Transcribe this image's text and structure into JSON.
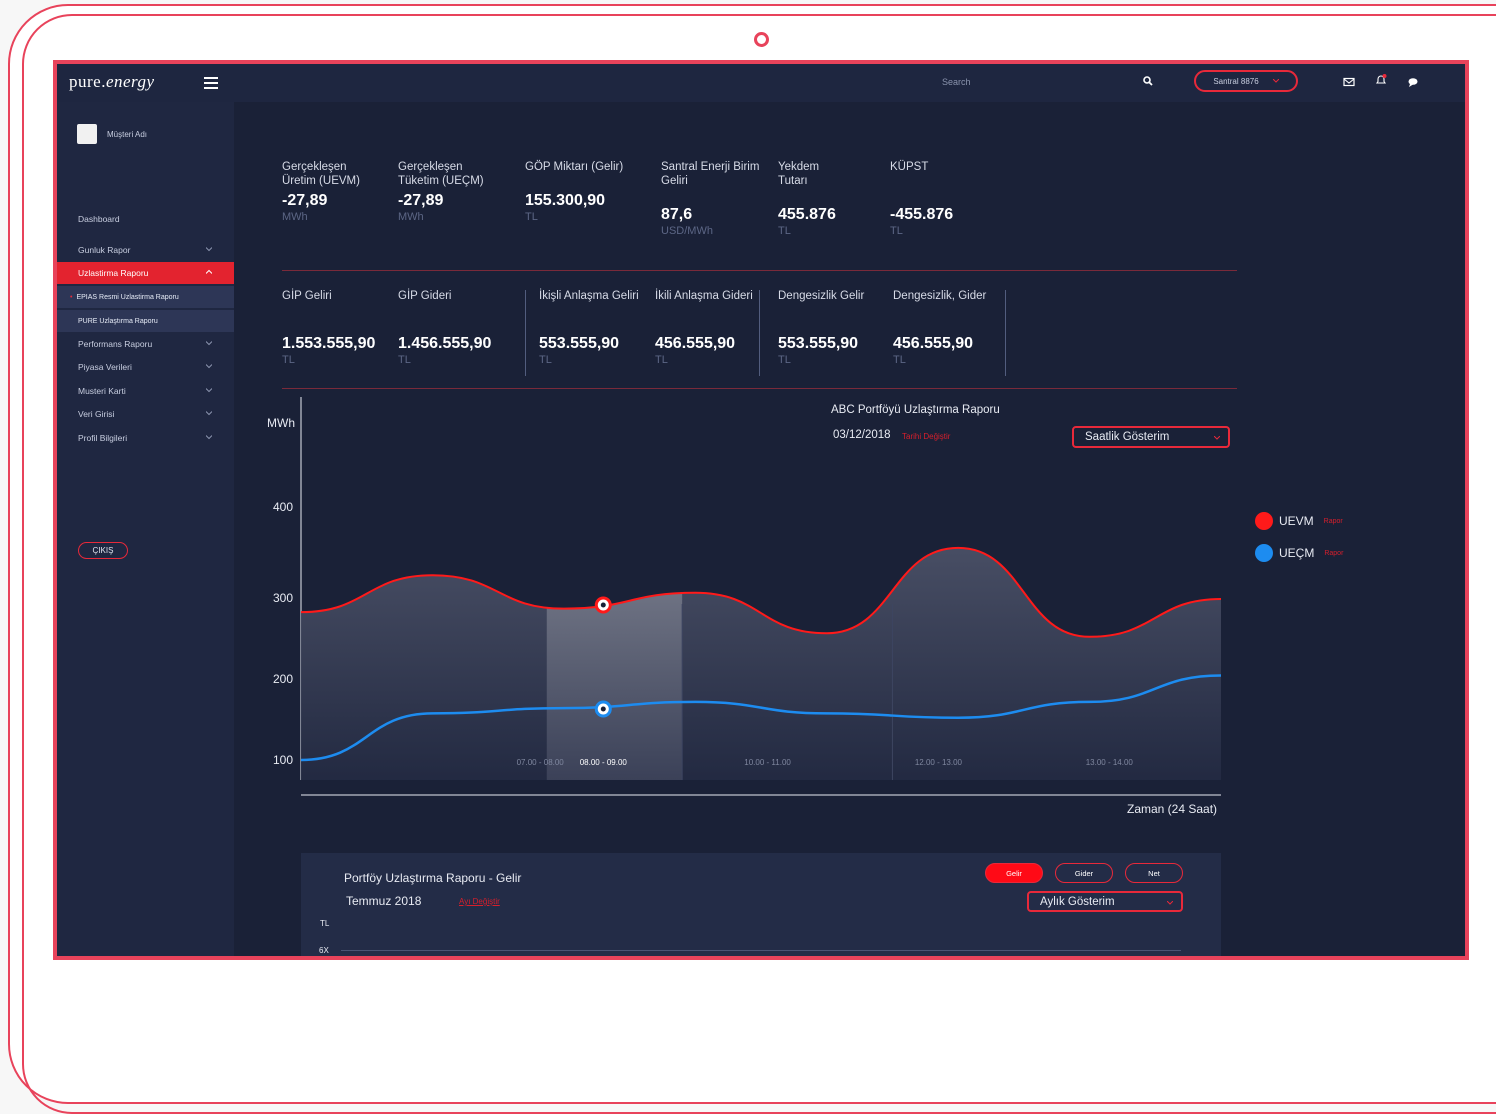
{
  "topbar": {
    "brand_plain": "pure.",
    "brand_italic": "energy",
    "search_placeholder": "Search",
    "plant_selector": "Santral 8876"
  },
  "sidebar": {
    "customer_name": "Müşteri Adı",
    "items": [
      {
        "label": "Dashboard"
      },
      {
        "label": "Gunluk Rapor"
      },
      {
        "label": "Uzlastirma Raporu"
      },
      {
        "label": "EPIAS Resmi Uzlastirma Raporu"
      },
      {
        "label": "PURE Uzlaştırma Raporu"
      },
      {
        "label": "Performans Raporu"
      },
      {
        "label": "Piyasa Verileri"
      },
      {
        "label": "Musteri Karti"
      },
      {
        "label": "Veri Girisi"
      },
      {
        "label": "Profil Bilgileri"
      }
    ],
    "logout": "ÇIKIŞ"
  },
  "stats_row1": [
    {
      "label": "Gerçekleşen Üretim (UEVM)",
      "value": "-27,89",
      "unit": "MWh"
    },
    {
      "label": "Gerçekleşen Tüketim (UEÇM)",
      "value": "-27,89",
      "unit": "MWh"
    },
    {
      "label": "GÖP Miktarı (Gelir)",
      "value": "155.300,90",
      "unit": "TL"
    },
    {
      "label": "Santral Enerji Birim Geliri",
      "value": "87,6",
      "unit": "USD/MWh"
    },
    {
      "label": "Yekdem Tutarı",
      "value": "455.876",
      "unit": "TL"
    },
    {
      "label": "KÜPST",
      "value": "-455.876",
      "unit": "TL"
    }
  ],
  "stats_row2": [
    {
      "label": "GİP Geliri",
      "value": "1.553.555,90",
      "unit": "TL"
    },
    {
      "label": "GİP Gideri",
      "value": "1.456.555,90",
      "unit": "TL"
    },
    {
      "label": "İkişli Anlaşma Geliri",
      "value": "553.555,90",
      "unit": "TL"
    },
    {
      "label": "İkili Anlaşma Gideri",
      "value": "456.555,90",
      "unit": "TL"
    },
    {
      "label": "Dengesizlik Gelir",
      "value": "553.555,90",
      "unit": "TL"
    },
    {
      "label": "Dengesizlik, Gider",
      "value": "456.555,90",
      "unit": "TL"
    }
  ],
  "chart": {
    "title": "ABC Portföyü Uzlaştırma Raporu",
    "date": "03/12/2018",
    "date_link": "Tarihi Değiştir",
    "view_select": "Saatlik Gösterim",
    "y_unit": "MWh",
    "x_label": "Zaman (24 Saat)",
    "legend_link": "Rapor"
  },
  "chart_data": {
    "type": "area",
    "y_ticks": [
      "400",
      "300",
      "200",
      "100"
    ],
    "x_ticks": [
      "07.00 - 08.00",
      "08.00 - 09.00",
      "10.00 - 11.00",
      "12.00 - 13.00",
      "13.00 - 14.00"
    ],
    "highlight_index": 1,
    "series": [
      {
        "name": "UEVM",
        "color": "#ff1a1a",
        "points": [
          [
            0,
            268
          ],
          [
            1,
            310
          ],
          [
            2,
            272
          ],
          [
            3,
            290
          ],
          [
            4,
            244
          ],
          [
            5,
            341
          ],
          [
            6,
            240
          ],
          [
            7,
            283
          ]
        ]
      },
      {
        "name": "UEÇM",
        "color": "#1d8cf0",
        "points": [
          [
            0,
            100
          ],
          [
            1,
            153
          ],
          [
            2,
            159
          ],
          [
            3,
            166
          ],
          [
            4,
            153
          ],
          [
            5,
            148
          ],
          [
            6,
            166
          ],
          [
            7,
            196
          ]
        ]
      }
    ]
  },
  "panel": {
    "title": "Portföy Uzlaştırma Raporu - Gelir",
    "date": "Temmuz 2018",
    "date_link": "Ayı Değiştir",
    "buttons": [
      "Gelir",
      "Gider",
      "Net"
    ],
    "view_select": "Aylık Gösterim",
    "y_unit": "TL",
    "y_top": "6X"
  },
  "colors": {
    "accent": "#e8293a",
    "bg": "#1a2137",
    "uevm": "#ff1a1a",
    "uecm": "#1d8cf0"
  }
}
